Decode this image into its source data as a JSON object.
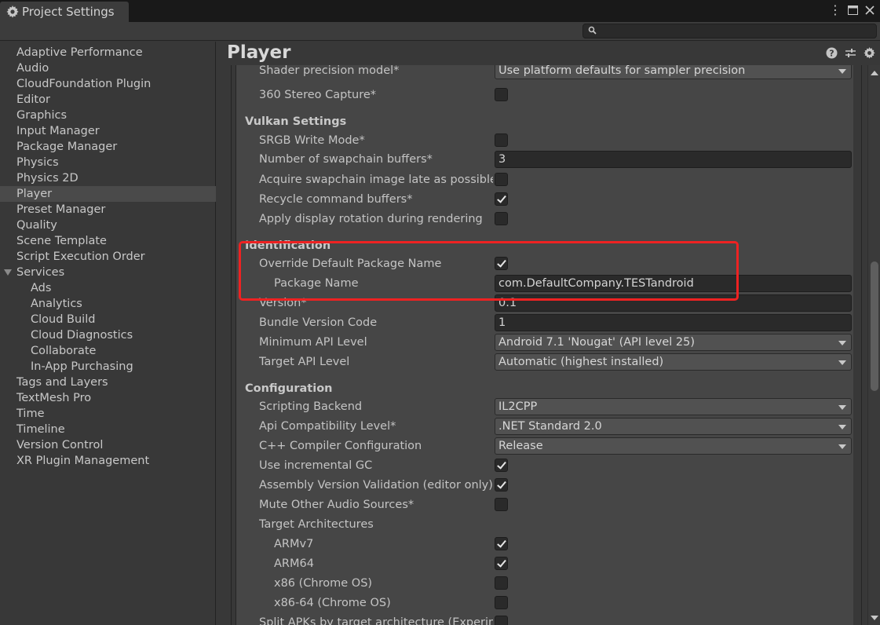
{
  "window": {
    "tab_title": "Project Settings",
    "icons": {
      "tab": "gear-icon",
      "menu": "kebab-menu-icon",
      "maximize": "maximize-icon",
      "close": "close-icon"
    }
  },
  "search": {
    "placeholder": "",
    "value": "",
    "icon": "search-icon"
  },
  "sidebar": {
    "items": [
      {
        "label": "Adaptive Performance",
        "level": 0
      },
      {
        "label": "Audio",
        "level": 0
      },
      {
        "label": "CloudFoundation Plugin",
        "level": 0
      },
      {
        "label": "Editor",
        "level": 0
      },
      {
        "label": "Graphics",
        "level": 0
      },
      {
        "label": "Input Manager",
        "level": 0
      },
      {
        "label": "Package Manager",
        "level": 0
      },
      {
        "label": "Physics",
        "level": 0
      },
      {
        "label": "Physics 2D",
        "level": 0
      },
      {
        "label": "Player",
        "level": 0,
        "selected": true
      },
      {
        "label": "Preset Manager",
        "level": 0
      },
      {
        "label": "Quality",
        "level": 0
      },
      {
        "label": "Scene Template",
        "level": 0
      },
      {
        "label": "Script Execution Order",
        "level": 0
      },
      {
        "label": "Services",
        "level": 0,
        "expanded": true
      },
      {
        "label": "Ads",
        "level": 1
      },
      {
        "label": "Analytics",
        "level": 1
      },
      {
        "label": "Cloud Build",
        "level": 1
      },
      {
        "label": "Cloud Diagnostics",
        "level": 1
      },
      {
        "label": "Collaborate",
        "level": 1
      },
      {
        "label": "In-App Purchasing",
        "level": 1
      },
      {
        "label": "Tags and Layers",
        "level": 0
      },
      {
        "label": "TextMesh Pro",
        "level": 0
      },
      {
        "label": "Time",
        "level": 0
      },
      {
        "label": "Timeline",
        "level": 0
      },
      {
        "label": "Version Control",
        "level": 0
      },
      {
        "label": "XR Plugin Management",
        "level": 0
      }
    ]
  },
  "main": {
    "title": "Player",
    "header_icons": [
      "help-icon",
      "presets-icon",
      "settings-gear-icon"
    ],
    "rows": [
      {
        "type": "dropdown",
        "label": "Shader precision model*",
        "value": "Use platform defaults for sampler precision"
      },
      {
        "type": "checkbox",
        "label": "360 Stereo Capture*",
        "checked": false
      },
      {
        "type": "header",
        "label": "Vulkan Settings"
      },
      {
        "type": "checkbox",
        "label": "SRGB Write Mode*",
        "checked": false
      },
      {
        "type": "text",
        "label": "Number of swapchain buffers*",
        "value": "3"
      },
      {
        "type": "checkbox",
        "label": "Acquire swapchain image late as possible*",
        "checked": false
      },
      {
        "type": "checkbox",
        "label": "Recycle command buffers*",
        "checked": true
      },
      {
        "type": "checkbox",
        "label": "Apply display rotation during rendering",
        "checked": false
      },
      {
        "type": "header",
        "label": "Identification"
      },
      {
        "type": "checkbox",
        "label": "Override Default Package Name",
        "checked": true
      },
      {
        "type": "text",
        "label": "Package Name",
        "value": "com.DefaultCompany.TESTandroid",
        "indent": true
      },
      {
        "type": "text",
        "label": "Version*",
        "value": "0.1"
      },
      {
        "type": "text",
        "label": "Bundle Version Code",
        "value": "1"
      },
      {
        "type": "dropdown",
        "label": "Minimum API Level",
        "value": "Android 7.1 'Nougat' (API level 25)"
      },
      {
        "type": "dropdown",
        "label": "Target API Level",
        "value": "Automatic (highest installed)"
      },
      {
        "type": "header",
        "label": "Configuration"
      },
      {
        "type": "dropdown",
        "label": "Scripting Backend",
        "value": "IL2CPP"
      },
      {
        "type": "dropdown",
        "label": "Api Compatibility Level*",
        "value": ".NET Standard 2.0"
      },
      {
        "type": "dropdown",
        "label": "C++ Compiler Configuration",
        "value": "Release"
      },
      {
        "type": "checkbox",
        "label": "Use incremental GC",
        "checked": true
      },
      {
        "type": "checkbox",
        "label": "Assembly Version Validation (editor only)",
        "checked": true
      },
      {
        "type": "checkbox",
        "label": "Mute Other Audio Sources*",
        "checked": false
      },
      {
        "type": "label",
        "label": "Target Architectures"
      },
      {
        "type": "checkbox",
        "label": "ARMv7",
        "checked": true,
        "indent": true
      },
      {
        "type": "checkbox",
        "label": "ARM64",
        "checked": true,
        "indent": true
      },
      {
        "type": "checkbox",
        "label": "x86 (Chrome OS)",
        "checked": false,
        "indent": true
      },
      {
        "type": "checkbox",
        "label": "x86-64 (Chrome OS)",
        "checked": false,
        "indent": true
      },
      {
        "type": "checkbox",
        "label": "Split APKs by target architecture (Experimental)",
        "checked": false
      }
    ]
  },
  "annotation": {
    "highlight_color": "#ee2222",
    "highlighted_section": "Identification"
  },
  "colors": {
    "background": "#383838",
    "content": "#464646",
    "selected": "#4a4a4a"
  }
}
